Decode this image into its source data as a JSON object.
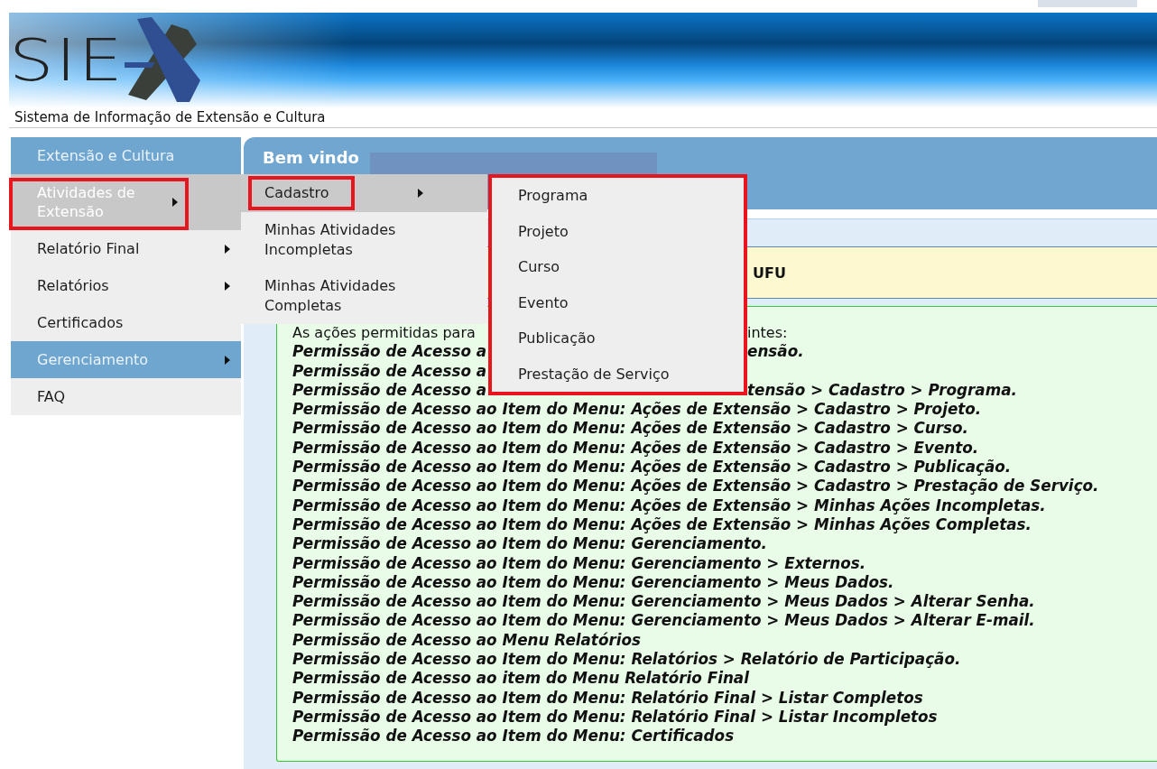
{
  "header": {
    "logo_text": "SIE",
    "subtitle": "Sistema de Informação de Extensão e Cultura"
  },
  "sidebar": {
    "items": [
      {
        "label": "Extensão e Cultura",
        "kind": "heading",
        "selected": false,
        "has_submenu": false,
        "annotated": false
      },
      {
        "label": "Atividades de Extensão",
        "kind": "item",
        "selected": true,
        "has_submenu": true,
        "annotated": true
      },
      {
        "label": "Relatório Final",
        "kind": "item",
        "selected": false,
        "has_submenu": true,
        "annotated": false
      },
      {
        "label": "Relatórios",
        "kind": "item",
        "selected": false,
        "has_submenu": true,
        "annotated": false
      },
      {
        "label": "Certificados",
        "kind": "item",
        "selected": false,
        "has_submenu": false,
        "annotated": false
      },
      {
        "label": "Gerenciamento",
        "kind": "heading",
        "selected": false,
        "has_submenu": true,
        "annotated": false
      },
      {
        "label": "FAQ",
        "kind": "item",
        "selected": false,
        "has_submenu": false,
        "annotated": false
      }
    ]
  },
  "submenu": {
    "items": [
      {
        "label": "Cadastro",
        "selected": true,
        "has_submenu": true,
        "annotated": true
      },
      {
        "label": "Minhas Atividades Incompletas",
        "selected": false,
        "has_submenu": false,
        "annotated": false
      },
      {
        "label": "Minhas Atividades Completas",
        "selected": false,
        "has_submenu": false,
        "annotated": false
      }
    ]
  },
  "submenu_2": {
    "annotated": true,
    "items": [
      "Programa",
      "Projeto",
      "Curso",
      "Evento",
      "Publicação",
      "Prestação de Serviço"
    ]
  },
  "main": {
    "greeting": "Bem vindo",
    "notice": "UFU",
    "lines": [
      {
        "kind": "plain",
        "parts": [
          "As ações permitidas para",
          "intes:"
        ]
      },
      {
        "kind": "permission",
        "parts": [
          "Permissão de Acesso a",
          "ensão."
        ]
      },
      {
        "kind": "permission",
        "parts": [
          "Permissão de Acesso a"
        ]
      },
      {
        "kind": "permission",
        "parts": [
          "Permissão de Acesso a",
          "tensão > Cadastro > Programa."
        ]
      },
      {
        "kind": "permission",
        "parts": [
          "Permissão de Acesso ao Item do Menu: Ações de Extensão > Cadastro > Projeto."
        ]
      },
      {
        "kind": "permission",
        "parts": [
          "Permissão de Acesso ao Item do Menu: Ações de Extensão > Cadastro > Curso."
        ]
      },
      {
        "kind": "permission",
        "parts": [
          "Permissão de Acesso ao Item do Menu: Ações de Extensão > Cadastro > Evento."
        ]
      },
      {
        "kind": "permission",
        "parts": [
          "Permissão de Acesso ao Item do Menu: Ações de Extensão > Cadastro > Publicação."
        ]
      },
      {
        "kind": "permission",
        "parts": [
          "Permissão de Acesso ao Item do Menu: Ações de Extensão > Cadastro > Prestação de Serviço."
        ]
      },
      {
        "kind": "permission",
        "parts": [
          "Permissão de Acesso ao Item do Menu: Ações de Extensão > Minhas Ações Incompletas."
        ]
      },
      {
        "kind": "permission",
        "parts": [
          "Permissão de Acesso ao Item do Menu: Ações de Extensão > Minhas Ações Completas."
        ]
      },
      {
        "kind": "permission",
        "parts": [
          "Permissão de Acesso ao Item do Menu: Gerenciamento."
        ]
      },
      {
        "kind": "permission",
        "parts": [
          "Permissão de Acesso ao Item do Menu: Gerenciamento > Externos."
        ]
      },
      {
        "kind": "permission",
        "parts": [
          "Permissão de Acesso ao Item do Menu: Gerenciamento > Meus Dados."
        ]
      },
      {
        "kind": "permission",
        "parts": [
          "Permissão de Acesso ao Item do Menu: Gerenciamento > Meus Dados > Alterar Senha."
        ]
      },
      {
        "kind": "permission",
        "parts": [
          "Permissão de Acesso ao Item do Menu: Gerenciamento > Meus Dados > Alterar E-mail."
        ]
      },
      {
        "kind": "permission",
        "parts": [
          "Permissão de Acesso ao Menu Relatórios"
        ]
      },
      {
        "kind": "permission",
        "parts": [
          "Permissão de Acesso ao Item do Menu: Relatórios > Relatório de Participação."
        ]
      },
      {
        "kind": "permission",
        "parts": [
          "Permissão de Acesso ao item do Menu Relatório Final"
        ]
      },
      {
        "kind": "permission",
        "parts": [
          "Permissão de Acesso ao Item do Menu: Relatório Final > Listar Completos"
        ]
      },
      {
        "kind": "permission",
        "parts": [
          "Permissão de Acesso ao Item do Menu: Relatório Final > Listar Incompletos"
        ]
      },
      {
        "kind": "permission",
        "parts": [
          "Permissão de Acesso ao Item do Menu: Certificados"
        ]
      }
    ]
  }
}
